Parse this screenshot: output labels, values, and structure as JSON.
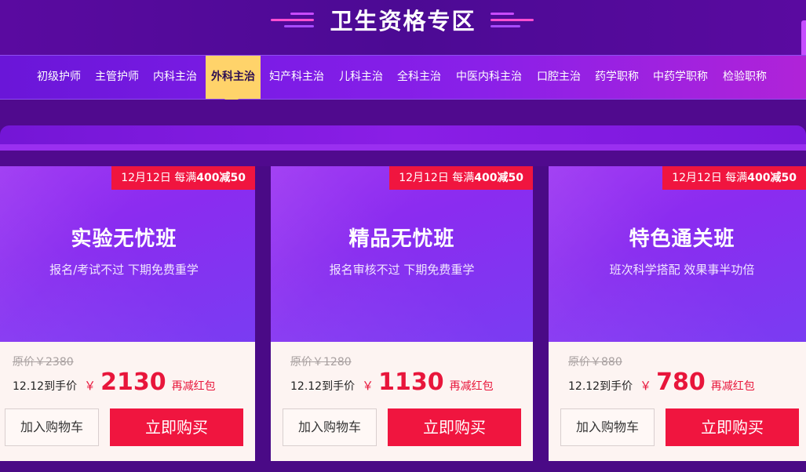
{
  "header": {
    "title": "卫生资格专区"
  },
  "tabs": [
    {
      "label": "初级护师",
      "active": false
    },
    {
      "label": "主管护师",
      "active": false
    },
    {
      "label": "内科主治",
      "active": false
    },
    {
      "label": "外科主治",
      "active": true
    },
    {
      "label": "妇产科主治",
      "active": false
    },
    {
      "label": "儿科主治",
      "active": false
    },
    {
      "label": "全科主治",
      "active": false
    },
    {
      "label": "中医内科主治",
      "active": false
    },
    {
      "label": "口腔主治",
      "active": false
    },
    {
      "label": "药学职称",
      "active": false
    },
    {
      "label": "中药学职称",
      "active": false
    },
    {
      "label": "检验职称",
      "active": false
    }
  ],
  "cards": [
    {
      "promo_date": "12月12日 每满",
      "promo_amount": "400减50",
      "title": "实验无忧班",
      "subtitle": "报名/考试不过 下期免费重学",
      "original_price": "原价￥2380",
      "price_label": "12.12到手价",
      "currency": "￥",
      "price": "2130",
      "price_note": "再减红包",
      "cart_label": "加入购物车",
      "buy_label": "立即购买"
    },
    {
      "promo_date": "12月12日 每满",
      "promo_amount": "400减50",
      "title": "精品无忧班",
      "subtitle": "报名审核不过 下期免费重学",
      "original_price": "原价￥1280",
      "price_label": "12.12到手价",
      "currency": "￥",
      "price": "1130",
      "price_note": "再减红包",
      "cart_label": "加入购物车",
      "buy_label": "立即购买"
    },
    {
      "promo_date": "12月12日 每满",
      "promo_amount": "400减50",
      "title": "特色通关班",
      "subtitle": "班次科学搭配 效果事半功倍",
      "original_price": "原价￥880",
      "price_label": "12.12到手价",
      "currency": "￥",
      "price": "780",
      "price_note": "再减红包",
      "cart_label": "加入购物车",
      "buy_label": "立即购买"
    }
  ],
  "colors": {
    "accent_red": "#f0153f",
    "tab_active": "#ffd36a",
    "header_purple": "#4c0a94"
  }
}
